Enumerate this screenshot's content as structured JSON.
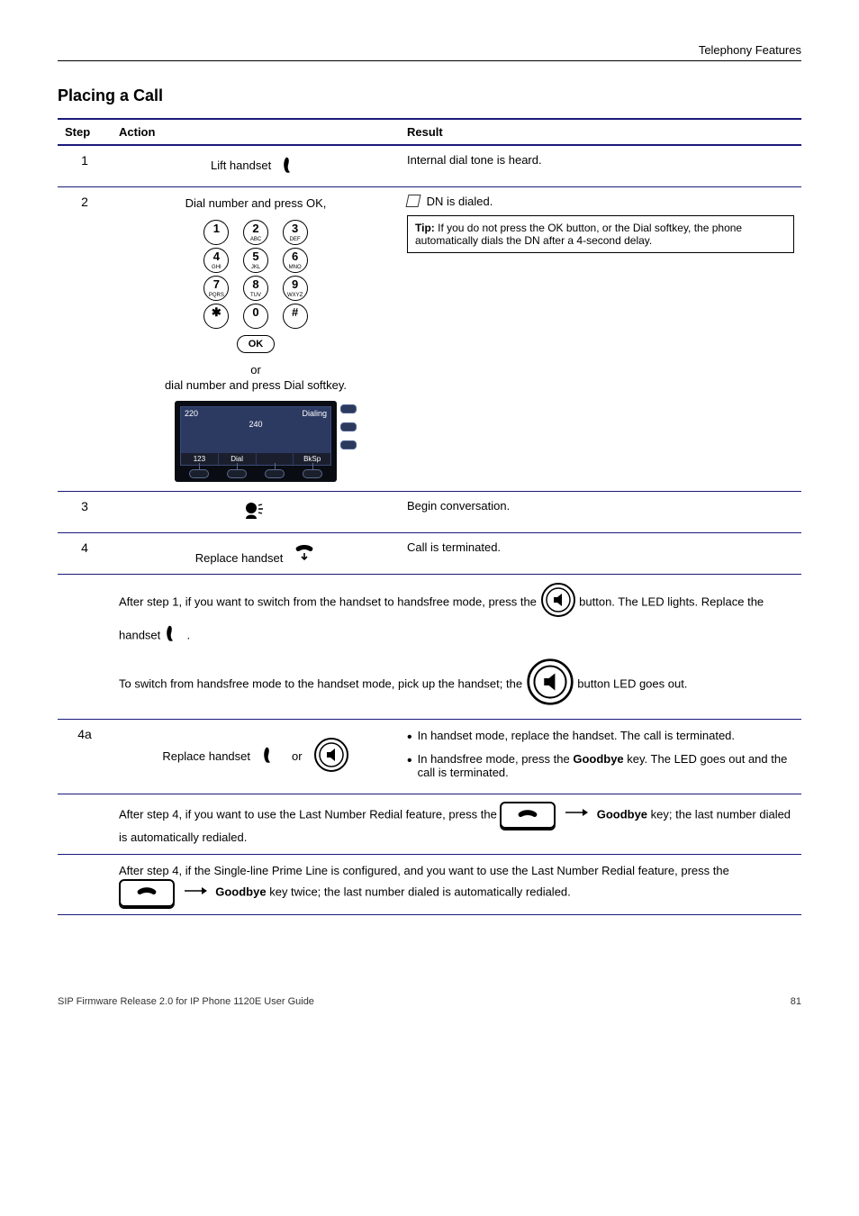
{
  "header": {
    "left": "",
    "right": "Telephony Features"
  },
  "section_title": "Placing a Call",
  "table": {
    "headers": {
      "step": "Step",
      "action": "Action",
      "result": "Result"
    },
    "row1": {
      "step": "1",
      "action_text": "Lift handset",
      "result": "Internal dial tone is heard."
    },
    "row2": {
      "step": "2",
      "action_prefix": "Dial number and press OK,",
      "action_or": "or",
      "action_suffix": "dial number and press Dial softkey.",
      "ok_label": "OK",
      "lcd": {
        "ext1": "220",
        "ext2": "240",
        "status": "Dialing",
        "soft1": "123",
        "soft2": "Dial",
        "soft3": "",
        "soft4": "BkSp"
      },
      "result_line1": "DN is dialed.",
      "tip_label": "Tip:",
      "tip_text": "If you do not press the OK button, or the Dial softkey, the phone automatically dials the DN after a 4-second delay.",
      "kp": {
        "1": "1",
        "2": "2",
        "2s": "ABC",
        "3": "3",
        "3s": "DEF",
        "4": "4",
        "4s": "GHI",
        "5": "5",
        "5s": "JKL",
        "6": "6",
        "6s": "MNO",
        "7": "7",
        "7s": "PQRS",
        "8": "8",
        "8s": "TUV",
        "9": "9",
        "9s": "WXYZ",
        "star": "✱",
        "0": "0",
        "hash": "#"
      }
    },
    "row3": {
      "step": "3",
      "result": "Begin conversation."
    },
    "row4": {
      "step": "4",
      "action_text": "Replace handset",
      "result": "Call is terminated."
    },
    "row5": {
      "step": "",
      "para1_pre": "After step 1, if you want to switch from the handset to handsfree mode, press the ",
      "para1_mid": " button. The LED lights. Replace the handset ",
      "para1_post": ".",
      "para2_pre": "To switch from handsfree mode to the handset mode, pick up the handset; the ",
      "para2_post": " button LED goes out."
    },
    "row6": {
      "step": "4a",
      "action_or": "or",
      "action_text": "Replace handset",
      "bullet1": "In handset mode, replace the handset. The call is terminated.",
      "bullet2_pre": "In handsfree mode, press the ",
      "bullet2_mid": "Goodbye",
      "bullet2_post": " key. The LED goes out and the call is terminated."
    },
    "row7": {
      "step": "",
      "text_pre": "After step 4, if you want to use the Last Number Redial feature, press the ",
      "text_key": "Goodbye",
      "text_mid": " key; the last number dialed is automatically redialed."
    },
    "row8": {
      "step": "",
      "text_pre": "After step 4, if the Single-line Prime Line is configured, and you want to use the Last Number Redial feature, press the ",
      "text_key": "Goodbye",
      "text_post": " key twice; the last number dialed is automatically redialed."
    }
  },
  "footer": {
    "left": "SIP Firmware Release 2.0 for IP Phone 1120E User Guide",
    "right": "81"
  }
}
